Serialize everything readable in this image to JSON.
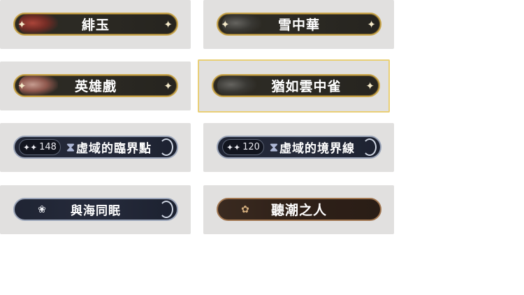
{
  "cards": [
    {
      "title": "緋玉",
      "style": "gold",
      "portrait": "red",
      "selected": false
    },
    {
      "title": "雪中華",
      "style": "gold",
      "portrait": "dark",
      "selected": false
    },
    {
      "title": "英雄戲",
      "style": "gold",
      "portrait": "pink",
      "selected": false
    },
    {
      "title": "猶如雲中雀",
      "style": "gold",
      "portrait": "dark",
      "selected": true
    },
    {
      "title": "虛域的臨界點",
      "style": "tech",
      "badge": "148",
      "icon": "hourglass-icon"
    },
    {
      "title": "虛域的境界線",
      "style": "tech",
      "badge": "120",
      "icon": "hourglass-icon"
    },
    {
      "title": "與海同眠",
      "style": "tech-plain",
      "icon": "fish-emblem-icon"
    },
    {
      "title": "聽潮之人",
      "style": "brown",
      "icon": "shell-emblem-icon"
    }
  ],
  "colors": {
    "card_bg": "#e1e0df",
    "gold_border": "#c9a54a",
    "selected_outline": "#e9cf76",
    "tech_plate": "#1f2433",
    "brown_plate": "#3a2a20"
  }
}
